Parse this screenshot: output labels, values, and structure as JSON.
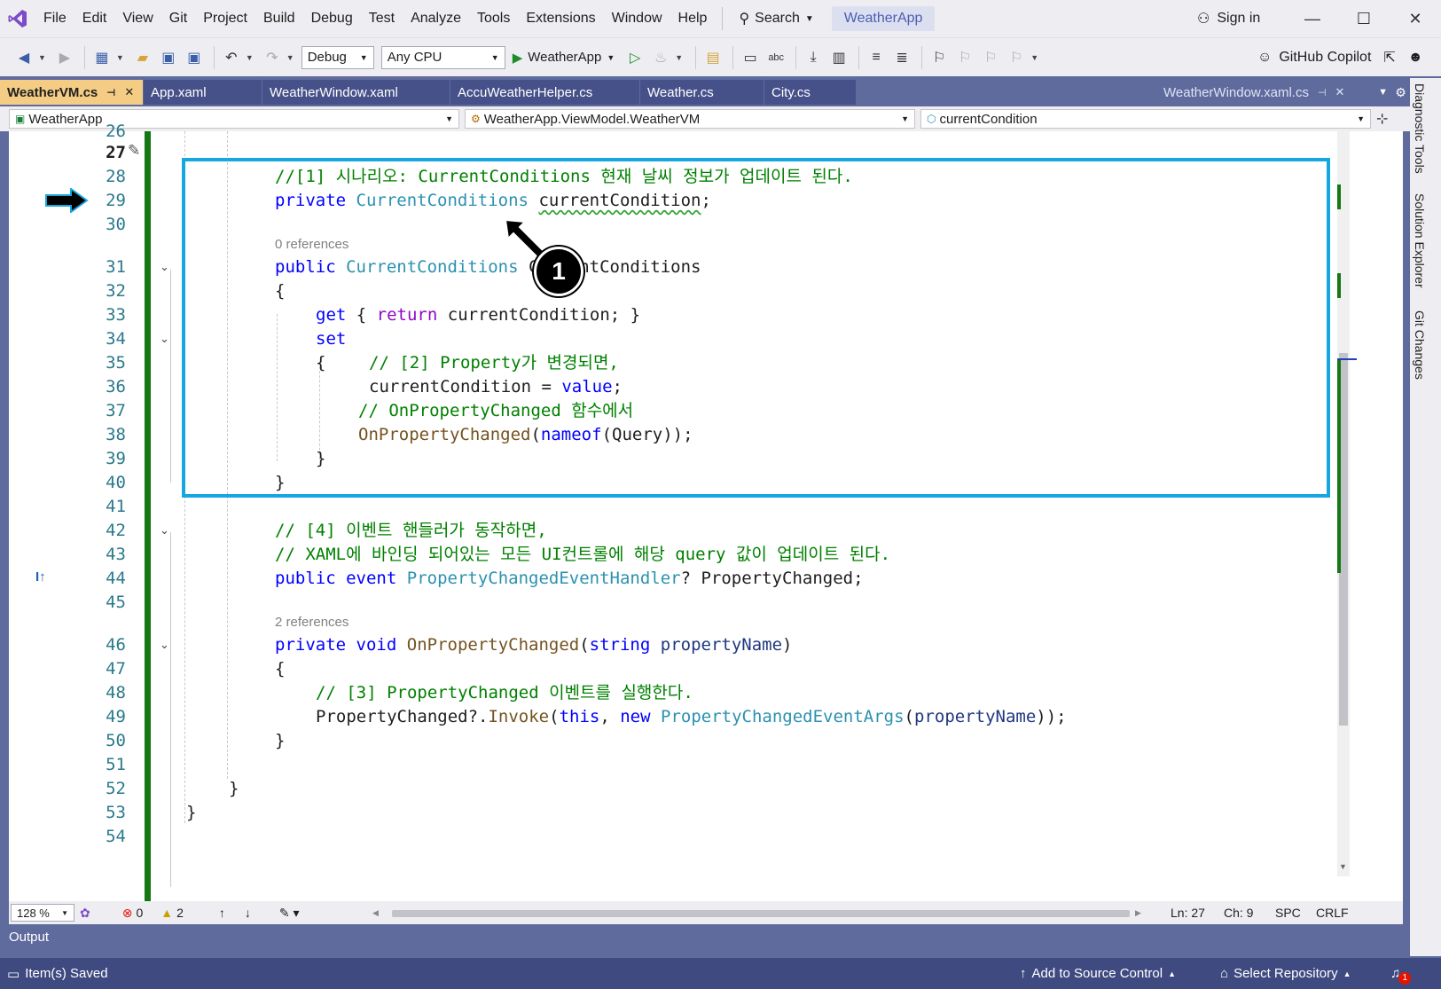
{
  "menubar": {
    "items": [
      "File",
      "Edit",
      "View",
      "Git",
      "Project",
      "Build",
      "Debug",
      "Test",
      "Analyze",
      "Tools",
      "Extensions",
      "Window",
      "Help"
    ],
    "search_label": "Search",
    "solution_name": "WeatherApp",
    "signin_label": "Sign in"
  },
  "toolbar": {
    "configuration": "Debug",
    "platform": "Any CPU",
    "run_target": "WeatherApp",
    "copilot_label": "GitHub Copilot"
  },
  "tabs": [
    {
      "label": "WeatherVM.cs",
      "active": true
    },
    {
      "label": "App.xaml",
      "active": false
    },
    {
      "label": "WeatherWindow.xaml",
      "active": false
    },
    {
      "label": "AccuWeatherHelper.cs",
      "active": false
    },
    {
      "label": "Weather.cs",
      "active": false
    },
    {
      "label": "City.cs",
      "active": false
    }
  ],
  "preview_tab": "WeatherWindow.xaml.cs",
  "navbar": {
    "project": "WeatherApp",
    "type": "WeatherApp.ViewModel.WeatherVM",
    "member": "currentCondition"
  },
  "code": {
    "l26": "26",
    "l27": "27",
    "l28": "28",
    "l29": "29",
    "l30": "30",
    "l31": "31",
    "l32": "32",
    "l33": "33",
    "l34": "34",
    "l35": "35",
    "l36": "36",
    "l37": "37",
    "l38": "38",
    "l39": "39",
    "l40": "40",
    "l41": "41",
    "l42": "42",
    "l43": "43",
    "l44": "44",
    "l45": "45",
    "l46": "46",
    "l47": "47",
    "l48": "48",
    "l49": "49",
    "l50": "50",
    "l51": "51",
    "l52": "52",
    "l53": "53",
    "l54": "54",
    "comment_1": "//[1] 시나리오: CurrentConditions 현재 날씨 정보가 업데이트 된다.",
    "kw_private": "private",
    "type_cc": "CurrentConditions",
    "field_name": "currentCondition",
    "semicolon": ";",
    "lens_0": "0 references",
    "kw_public": "public",
    "prop_name": "CurrentConditions",
    "brace_open": "{",
    "brace_close": "}",
    "kw_get": "get",
    "kw_return": "return",
    "get_rest": "currentCondition; }",
    "kw_set": "set",
    "comment_2": "// [2] Property가 변경되면,",
    "assign_lhs": "currentCondition = ",
    "kw_value": "value",
    "comment_3": "// OnPropertyChanged 함수에서",
    "call_opc": "OnPropertyChanged",
    "kw_nameof": "nameof",
    "call_rest": "(Query));",
    "comment_4": "// [4] 이벤트 핸들러가 동작하면,",
    "comment_5": "// XAML에 바인딩 되어있는 모든 UI컨트롤에 해당 query 값이 업데이트 된다.",
    "kw_event": "event",
    "type_pceh": "PropertyChangedEventHandler",
    "event_rest": "? PropertyChanged;",
    "lens_2": "2 references",
    "kw_void": "void",
    "method_opc": "OnPropertyChanged",
    "kw_string": "string",
    "param": "propertyName",
    "comment_6": "// [3] PropertyChanged 이벤트를 실행한다.",
    "invoke_lhs": "PropertyChanged?.",
    "invoke": "Invoke",
    "kw_this": "this",
    "kw_new": "new",
    "type_pcea": "PropertyChangedEventArgs",
    "callout_number": "1"
  },
  "editor_status": {
    "zoom": "128 %",
    "errors": "0",
    "warnings": "2",
    "line": "Ln: 27",
    "col": "Ch: 9",
    "spacing": "SPC",
    "eol": "CRLF"
  },
  "output_label": "Output",
  "statusbar": {
    "message": "Item(s) Saved",
    "source_control": "Add to Source Control",
    "repository": "Select Repository",
    "notifications": "1"
  },
  "side_tabs": [
    "Diagnostic Tools",
    "Solution Explorer",
    "Git Changes"
  ],
  "colors": {
    "accent": "#5f6b9d",
    "active_tab": "#f5cc84",
    "highlight_box": "#17a7e0",
    "change_bar": "#157815"
  }
}
